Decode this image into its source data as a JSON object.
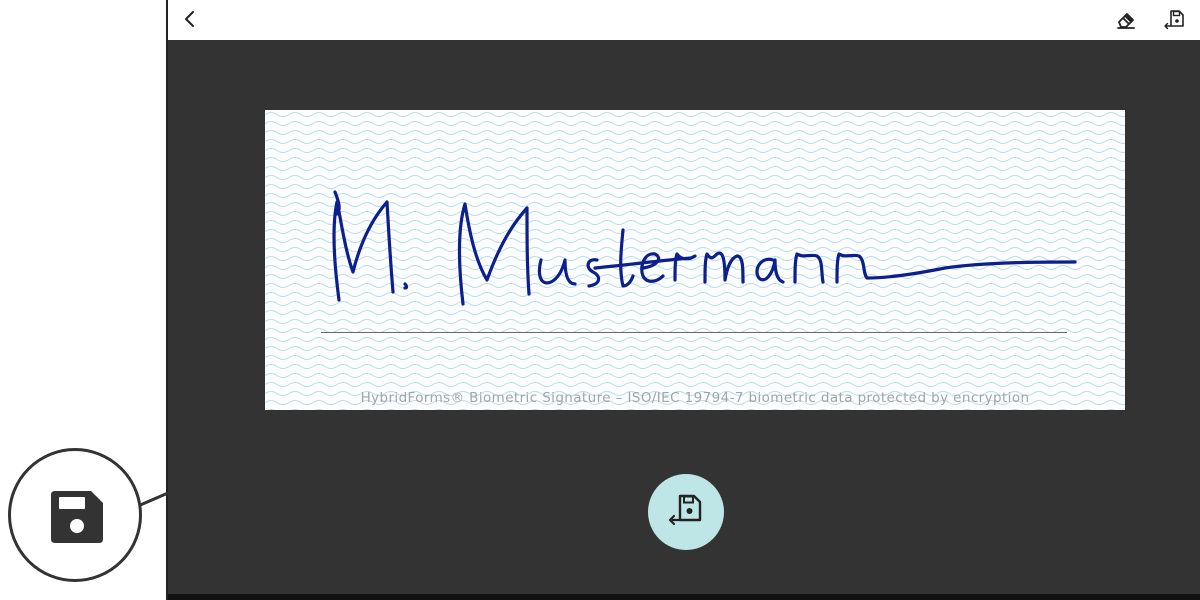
{
  "topbar": {
    "back_icon": "chevron-left-icon",
    "eraser_icon": "eraser-icon",
    "save_icon": "save-return-icon"
  },
  "signature_pad": {
    "signature_text": "M. Mustermann",
    "signature_color": "#0d1f8c",
    "caption": "HybridForms® Biometric Signature  –  ISO/IEC 19794-7 biometric data protected by encryption"
  },
  "fab": {
    "icon": "save-return-icon",
    "color": "#bfe6e6"
  },
  "callout": {
    "icon": "floppy-disk-icon"
  }
}
